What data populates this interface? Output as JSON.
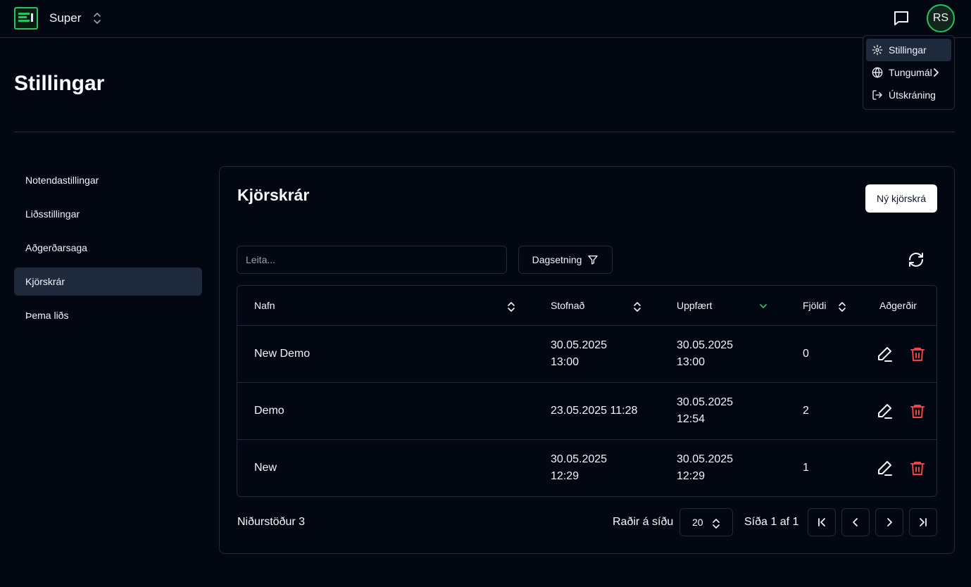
{
  "app": {
    "workspace": "Super",
    "avatar_initials": "RS"
  },
  "user_menu": {
    "items": [
      {
        "label": "Stillingar",
        "icon": "gear-icon"
      },
      {
        "label": "Tungumál",
        "icon": "globe-icon"
      },
      {
        "label": "Útskráning",
        "icon": "logout-icon"
      }
    ]
  },
  "page": {
    "title": "Stillingar"
  },
  "sidebar": {
    "items": [
      {
        "label": "Notendastillingar"
      },
      {
        "label": "Liðsstillingar"
      },
      {
        "label": "Aðgerðarsaga"
      },
      {
        "label": "Kjörskrár"
      },
      {
        "label": "Þema liðs"
      }
    ]
  },
  "card": {
    "title": "Kjörskrár",
    "new_button": "Ný kjörskrá",
    "search_placeholder": "Leita...",
    "date_filter": "Dagsetning"
  },
  "table": {
    "columns": [
      "Nafn",
      "Stofnað",
      "Uppfært",
      "Fjöldi",
      "Aðgerðir"
    ],
    "rows": [
      {
        "name": "New Demo",
        "created_1": "30.05.2025",
        "created_2": "13:00",
        "updated_1": "30.05.2025",
        "updated_2": "13:00",
        "count": "0"
      },
      {
        "name": "Demo",
        "created_1": "23.05.2025 11:28",
        "created_2": "",
        "updated_1": "30.05.2025",
        "updated_2": "12:54",
        "count": "2"
      },
      {
        "name": "New",
        "created_1": "30.05.2025",
        "created_2": "12:29",
        "updated_1": "30.05.2025",
        "updated_2": "12:29",
        "count": "1"
      }
    ]
  },
  "pagination": {
    "results": "Niðurstöður 3",
    "rows_per_page_label": "Raðir á síðu",
    "rows_per_page": "20",
    "page_info": "Síða 1 af 1"
  },
  "colors": {
    "background": "#030711",
    "border": "#1e293b",
    "accent": "#22c55e",
    "danger": "#ef4444"
  }
}
